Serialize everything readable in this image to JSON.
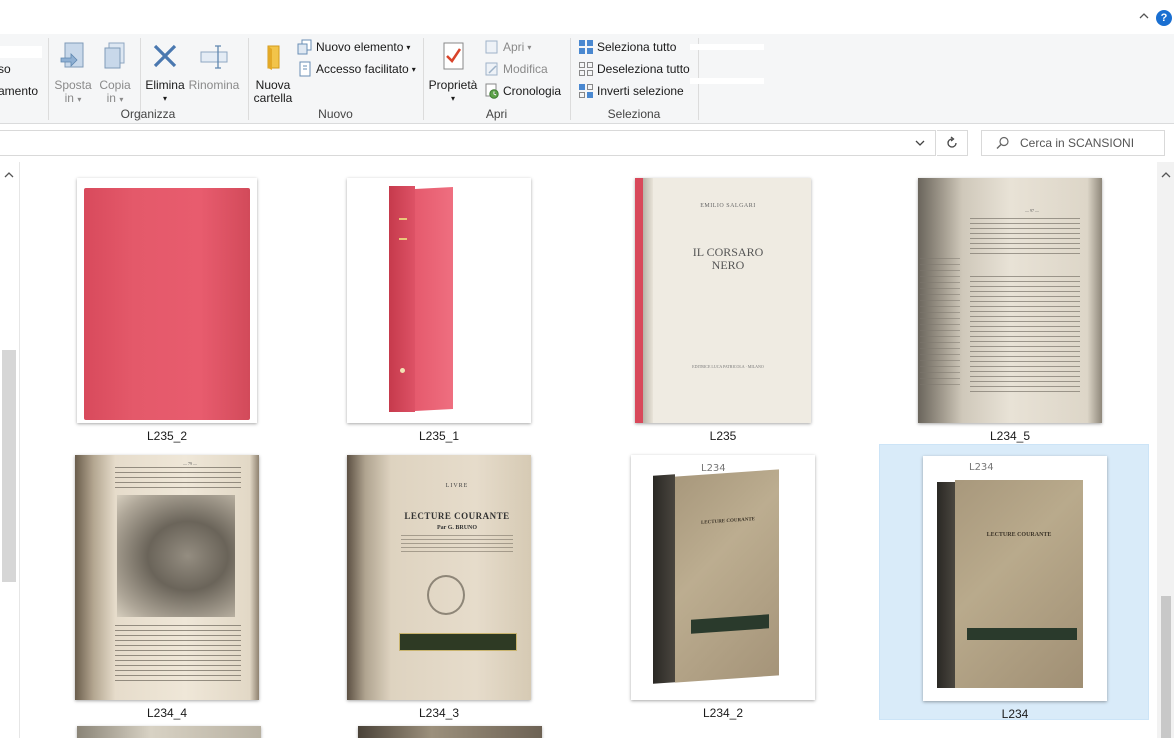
{
  "ribbon": {
    "cut_left_1": "so",
    "cut_left_2": "amento",
    "organizza": {
      "label": "Organizza",
      "sposta": "Sposta",
      "sposta_in": "in",
      "copia": "Copia",
      "copia_in": "in",
      "elimina": "Elimina",
      "rinomina": "Rinomina"
    },
    "nuovo": {
      "label": "Nuovo",
      "cartella_1": "Nuova",
      "cartella_2": "cartella",
      "nuovo_elemento": "Nuovo elemento",
      "accesso_facilitato": "Accesso facilitato"
    },
    "apri": {
      "label": "Apri",
      "proprieta": "Proprietà",
      "apri": "Apri",
      "modifica": "Modifica",
      "cronologia": "Cronologia"
    },
    "seleziona": {
      "label": "Seleziona",
      "seleziona_tutto": "Seleziona tutto",
      "deseleziona_tutto": "Deseleziona tutto",
      "inverti_selezione": "Inverti selezione"
    }
  },
  "search": {
    "placeholder": "Cerca in SCANSIONI"
  },
  "help": "?",
  "files": [
    {
      "name": "L235_2"
    },
    {
      "name": "L235_1"
    },
    {
      "name": "L235"
    },
    {
      "name": "L234_5"
    },
    {
      "name": "L234_4"
    },
    {
      "name": "L234_3"
    },
    {
      "name": "L234_2"
    },
    {
      "name": "L234"
    }
  ],
  "thumb_text": {
    "corsaro_author": "EMILIO SALGARI",
    "corsaro_title_1": "IL CORSARO",
    "corsaro_title_2": "NERO",
    "corsaro_publisher": "EDITRICE LUCA PATRICOLA · MILANO",
    "livre_1": "LIVRE",
    "lecture_courante": "LECTURE COURANTE",
    "par": "Par G. BRUNO",
    "l234_handwritten": "L234",
    "page_num_97": "— 97 —",
    "page_num_79": "— 79 —"
  }
}
